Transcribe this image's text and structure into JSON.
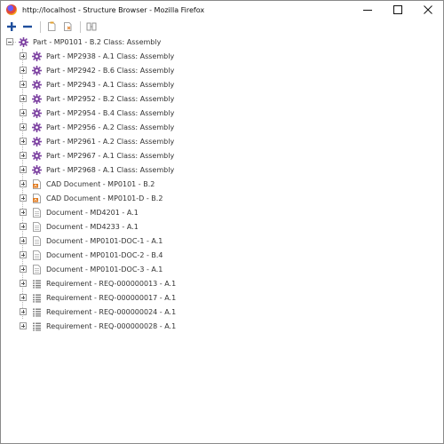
{
  "window": {
    "title": "http://localhost - Structure Browser - Mozilla Firefox"
  },
  "toolbar": {
    "buttons": [
      "expand-all",
      "collapse-all",
      "copy",
      "paste",
      "compare"
    ]
  },
  "tree": {
    "root": {
      "label": "Part - MP0101 - B.2 Class: Assembly",
      "icon": "gear-icon",
      "expanded": true
    },
    "children": [
      {
        "label": "Part - MP2938 - A.1 Class: Assembly",
        "icon": "gear-icon"
      },
      {
        "label": "Part - MP2942 - B.6 Class: Assembly",
        "icon": "gear-icon"
      },
      {
        "label": "Part - MP2943 - A.1 Class: Assembly",
        "icon": "gear-icon"
      },
      {
        "label": "Part - MP2952 - B.2 Class: Assembly",
        "icon": "gear-icon"
      },
      {
        "label": "Part - MP2954 - B.4 Class: Assembly",
        "icon": "gear-icon"
      },
      {
        "label": "Part - MP2956 - A.2 Class: Assembly",
        "icon": "gear-icon"
      },
      {
        "label": "Part - MP2961 - A.2 Class: Assembly",
        "icon": "gear-icon"
      },
      {
        "label": "Part - MP2967 - A.1 Class: Assembly",
        "icon": "gear-icon"
      },
      {
        "label": "Part - MP2968 - A.1 Class: Assembly",
        "icon": "gear-icon"
      },
      {
        "label": "CAD Document - MP0101 - B.2",
        "icon": "cad-document-icon"
      },
      {
        "label": "CAD Document - MP0101-D - B.2",
        "icon": "cad-document-icon"
      },
      {
        "label": "Document - MD4201 - A.1",
        "icon": "document-icon"
      },
      {
        "label": "Document - MD4233 - A.1",
        "icon": "document-icon"
      },
      {
        "label": "Document - MP0101-DOC-1 - A.1",
        "icon": "document-icon"
      },
      {
        "label": "Document - MP0101-DOC-2 - B.4",
        "icon": "document-icon"
      },
      {
        "label": "Document - MP0101-DOC-3 - A.1",
        "icon": "document-icon"
      },
      {
        "label": "Requirement - REQ-000000013 - A.1",
        "icon": "requirement-icon"
      },
      {
        "label": "Requirement - REQ-000000017 - A.1",
        "icon": "requirement-icon"
      },
      {
        "label": "Requirement - REQ-000000024 - A.1",
        "icon": "requirement-icon"
      },
      {
        "label": "Requirement - REQ-000000028 - A.1",
        "icon": "requirement-icon"
      }
    ]
  },
  "colors": {
    "gear": "#7b3fa0",
    "cad": "#e07a1f",
    "toolbar_blue": "#1f4e9c",
    "tree_line": "#b5b5b5"
  }
}
